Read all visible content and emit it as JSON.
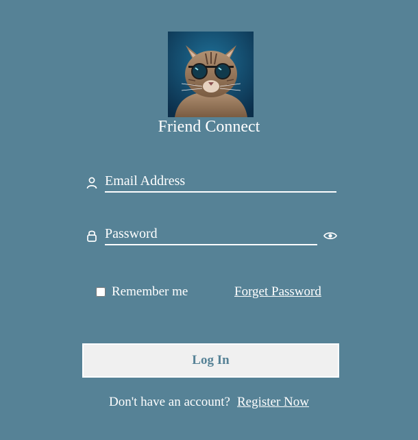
{
  "app": {
    "title": "Friend Connect"
  },
  "logo": {
    "icon": "cat-with-sunglasses-image"
  },
  "form": {
    "email": {
      "placeholder": "Email Address",
      "value": "",
      "icon": "user-icon"
    },
    "password": {
      "placeholder": "Password",
      "value": "",
      "icon": "lock-icon",
      "toggle_icon": "eye-icon"
    },
    "remember": {
      "label": "Remember me",
      "checked": false
    },
    "forget_label": "Forget Password",
    "login_label": "Log In"
  },
  "register": {
    "prompt": "Don't have an account?",
    "link_label": "Register Now"
  },
  "colors": {
    "background": "#568296",
    "text": "#ffffff",
    "button_bg": "#f0f0f0",
    "button_text": "#568296"
  }
}
